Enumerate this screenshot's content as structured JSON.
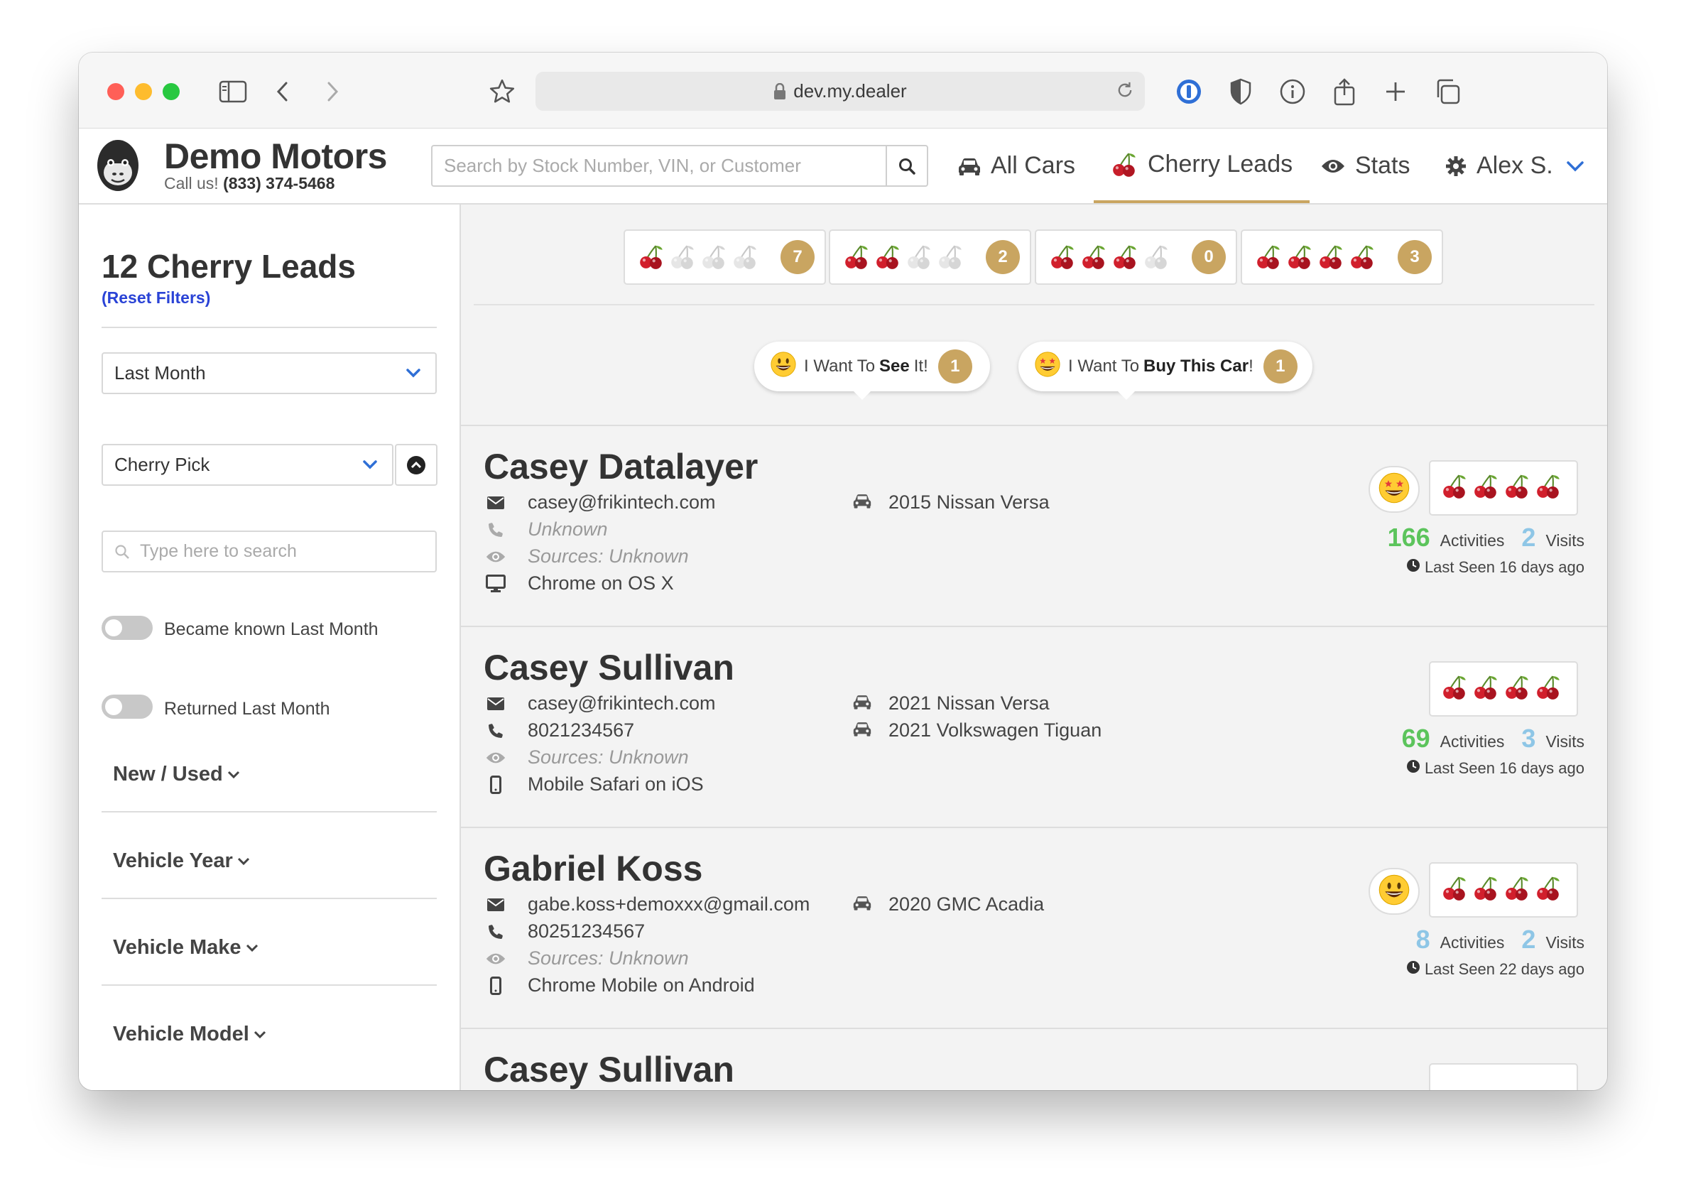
{
  "browser": {
    "url": "dev.my.dealer"
  },
  "header": {
    "brand": "Demo Motors",
    "call_label": "Call us!",
    "phone": "(833) 374-5468",
    "search_placeholder": "Search by Stock Number, VIN, or Customer",
    "nav": [
      "All Cars",
      "Cherry Leads",
      "Stats",
      "Alex S."
    ],
    "active_nav": "Cherry Leads"
  },
  "sidebar": {
    "title": "12 Cherry Leads",
    "reset": "(Reset Filters)",
    "period_select": "Last Month",
    "sort_select": "Cherry Pick",
    "search_placeholder": "Type here to search",
    "toggles": [
      "Became known Last Month",
      "Returned Last Month"
    ],
    "filters": [
      "New / Used",
      "Vehicle Year",
      "Vehicle Make",
      "Vehicle Model"
    ]
  },
  "cherry_filters": [
    {
      "cherries": 1,
      "count": "7"
    },
    {
      "cherries": 2,
      "count": "2"
    },
    {
      "cherries": 3,
      "count": "0"
    },
    {
      "cherries": 4,
      "count": "3"
    }
  ],
  "intent_bubbles": [
    {
      "prefix": "I Want To",
      "strong": "See",
      "suffix": "It!",
      "count": "1",
      "emoji": "grinning-face"
    },
    {
      "prefix": "I Want To",
      "strong": "Buy This Car",
      "suffix": "!",
      "count": "1",
      "emoji": "star-struck-face"
    }
  ],
  "leads": [
    {
      "name": "Casey Datalayer",
      "email": "casey@frikintech.com",
      "phone": "Unknown",
      "sources": "Sources: Unknown",
      "device": "Chrome on OS X",
      "device_icon": "desktop-icon",
      "cars": [
        "2015 Nissan Versa"
      ],
      "emoji": "star-struck-face",
      "activities": "166",
      "activities_label": "Activities",
      "activity_color": "#5cc45c",
      "visits": "2",
      "visits_label": "Visits",
      "last_seen": "Last Seen 16 days ago"
    },
    {
      "name": "Casey Sullivan",
      "email": "casey@frikintech.com",
      "phone": "8021234567",
      "sources": "Sources: Unknown",
      "device": "Mobile Safari on iOS",
      "device_icon": "mobile-icon",
      "cars": [
        "2021 Nissan Versa",
        "2021 Volkswagen Tiguan"
      ],
      "emoji": "",
      "activities": "69",
      "activities_label": "Activities",
      "activity_color": "#5cc45c",
      "visits": "3",
      "visits_label": "Visits",
      "last_seen": "Last Seen 16 days ago"
    },
    {
      "name": "Gabriel Koss",
      "email": "gabe.koss+demoxxx@gmail.com",
      "phone": "80251234567",
      "sources": "Sources: Unknown",
      "device": "Chrome Mobile on Android",
      "device_icon": "mobile-icon",
      "cars": [
        "2020 GMC Acadia"
      ],
      "emoji": "grinning-face",
      "activities": "8",
      "activities_label": "Activities",
      "activity_color": "#8ec6e6",
      "visits": "2",
      "visits_label": "Visits",
      "last_seen": "Last Seen 22 days ago"
    },
    {
      "name": "Casey Sullivan"
    }
  ],
  "colors": {
    "accent": "#c9a561",
    "link": "#2a43d6",
    "nav_chevron": "#2f6fd6"
  }
}
